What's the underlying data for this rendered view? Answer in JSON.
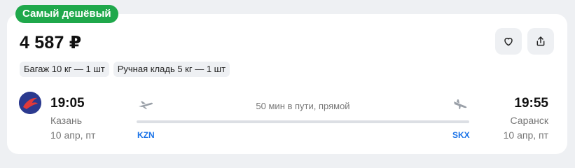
{
  "badge": "Самый дешёвый",
  "price": "4 587 ₽",
  "baggage_tags": [
    "Багаж 10 кг — 1 шт",
    "Ручная кладь 5 кг — 1 шт"
  ],
  "actions": {
    "like_icon": "heart-icon",
    "share_icon": "share-icon"
  },
  "flight": {
    "airline_logo": "airline-logo",
    "departure": {
      "time": "19:05",
      "city": "Казань",
      "date": "10 апр, пт",
      "iata": "KZN"
    },
    "arrival": {
      "time": "19:55",
      "city": "Саранск",
      "date": "10 апр, пт",
      "iata": "SKX"
    },
    "duration": "50 мин в пути, прямой"
  },
  "colors": {
    "badge": "#1fa84b",
    "iata": "#1a73e8",
    "airline_logo": "#2b3a8f",
    "airline_logo_mark": "#e03a3a"
  }
}
